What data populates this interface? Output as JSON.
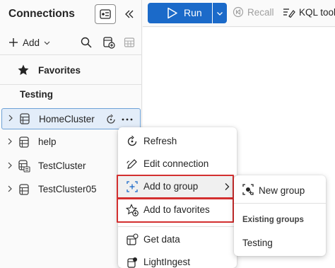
{
  "connections_pane": {
    "title": "Connections",
    "toolbar": {
      "add_label": "Add"
    },
    "favorites_label": "Favorites",
    "group_name": "Testing",
    "clusters": [
      {
        "label": "HomeCluster",
        "selected": true
      },
      {
        "label": "help",
        "selected": false
      },
      {
        "label": "TestCluster",
        "selected": false
      },
      {
        "label": "TestCluster05",
        "selected": false
      }
    ]
  },
  "query_toolbar": {
    "run_label": "Run",
    "recall_label": "Recall",
    "kql_tools_label": "KQL tool"
  },
  "context_menu": {
    "items": [
      {
        "label": "Refresh",
        "icon": "refresh-icon"
      },
      {
        "label": "Edit connection",
        "icon": "edit-link-icon"
      },
      {
        "label": "Add to group",
        "icon": "group-add-icon",
        "has_submenu": true,
        "highlighted": true
      },
      {
        "label": "Add to favorites",
        "icon": "star-add-icon",
        "highlighted": true
      },
      {
        "label": "Get data",
        "icon": "get-data-icon"
      },
      {
        "label": "LightIngest",
        "icon": "lightingest-icon"
      }
    ]
  },
  "submenu": {
    "new_group_label": "New group",
    "existing_heading": "Existing groups",
    "existing_groups": [
      "Testing"
    ]
  },
  "colors": {
    "accent": "#1b6ac9",
    "selection_bg": "#e3edf9",
    "selection_border": "#6da1d6",
    "highlight_red": "#d32f2f"
  }
}
